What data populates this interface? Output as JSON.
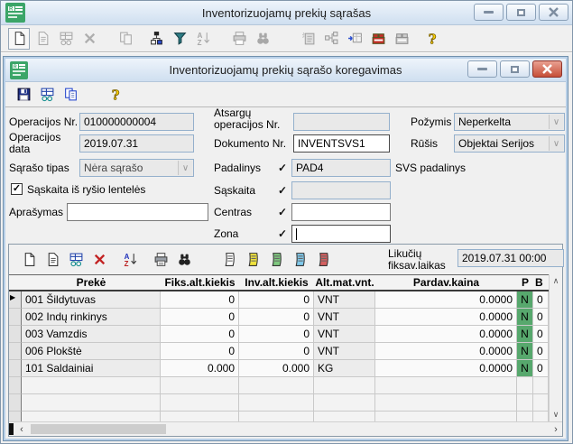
{
  "icons": {
    "checkmark": "✓",
    "scroll_up": "∧",
    "scroll_down": "∨",
    "scroll_left": "‹",
    "scroll_right": "›",
    "row_marker": "▶"
  },
  "main_window": {
    "title": "Inventorizuojamų prekių sąrašas",
    "toolbar_icons": [
      "new-document",
      "open-document",
      "edit-record",
      "delete",
      "copy",
      "filter-tree",
      "filter-funnel",
      "sort-az",
      "print",
      "find",
      "import-item",
      "link-tree",
      "send-to-grid",
      "register-red",
      "register-gray",
      "help"
    ]
  },
  "dialog": {
    "title": "Inventorizuojamų prekių sąrašo koregavimas",
    "toolbar_icons": [
      "save",
      "edit-record",
      "copy",
      "help"
    ],
    "form": {
      "operacijos_nr_label": "Operacijos Nr.",
      "operacijos_nr_value": "010000000004",
      "operacijos_data_label": "Operacijos data",
      "operacijos_data_value": "2019.07.31",
      "saraso_tipas_label": "Sąrašo tipas",
      "saraso_tipas_value": "Nėra sąrašo",
      "atsargu_label": "Atsargų operacijos Nr.",
      "atsargu_value": "",
      "dokumento_label": "Dokumento Nr.",
      "dokumento_value": "INVENTSVS1",
      "padalinys_label": "Padalinys",
      "padalinys_value": "PAD4",
      "svs_label": "SVS padalinys",
      "pozymis_label": "Požymis",
      "pozymis_value": "Neperkelta",
      "rusis_label": "Rūšis",
      "rusis_value": "Objektai Serijos",
      "checkbox_label": "Sąskaita iš ryšio lentelės",
      "checkbox_checked": true,
      "aprasymas_label": "Aprašymas",
      "aprasymas_value": "",
      "saskaita_label": "Sąskaita",
      "saskaita_value": "",
      "centras_label": "Centras",
      "centras_value": "",
      "zona_label": "Zona",
      "zona_value": ""
    },
    "grid_panel": {
      "toolbar_icons": [
        "new-row",
        "view-row",
        "edit-row",
        "delete-row",
        "sort-az",
        "print",
        "find",
        "journal-white",
        "journal-yellow",
        "journal-green",
        "journal-cyan",
        "journal-red"
      ],
      "fiksav_label": "Likučių fiksav.laikas",
      "fiksav_value": "2019.07.31 00:00",
      "table": {
        "columns": [
          "Prekė",
          "Fiks.alt.kiekis",
          "Inv.alt.kiekis",
          "Alt.mat.vnt.",
          "Pardav.kaina",
          "P",
          "B"
        ],
        "rows": [
          {
            "name": "001 Šildytuvas",
            "fiks": "0",
            "inv": "0",
            "unit": "VNT",
            "price": "0.0000",
            "p": "N",
            "b": "0"
          },
          {
            "name": "002 Indų rinkinys",
            "fiks": "0",
            "inv": "0",
            "unit": "VNT",
            "price": "0.0000",
            "p": "N",
            "b": "0"
          },
          {
            "name": "003 Vamzdis",
            "fiks": "0",
            "inv": "0",
            "unit": "VNT",
            "price": "0.0000",
            "p": "N",
            "b": "0"
          },
          {
            "name": "006 Plokštė",
            "fiks": "0",
            "inv": "0",
            "unit": "VNT",
            "price": "0.0000",
            "p": "N",
            "b": "0"
          },
          {
            "name": "101 Saldainiai",
            "fiks": "0.000",
            "inv": "0.000",
            "unit": "KG",
            "price": "0.0000",
            "p": "N",
            "b": "0"
          }
        ]
      }
    },
    "colors": {
      "green_cell": "#57a86d",
      "close_red": "#c64f38",
      "input_border": "#94b0cc"
    }
  }
}
